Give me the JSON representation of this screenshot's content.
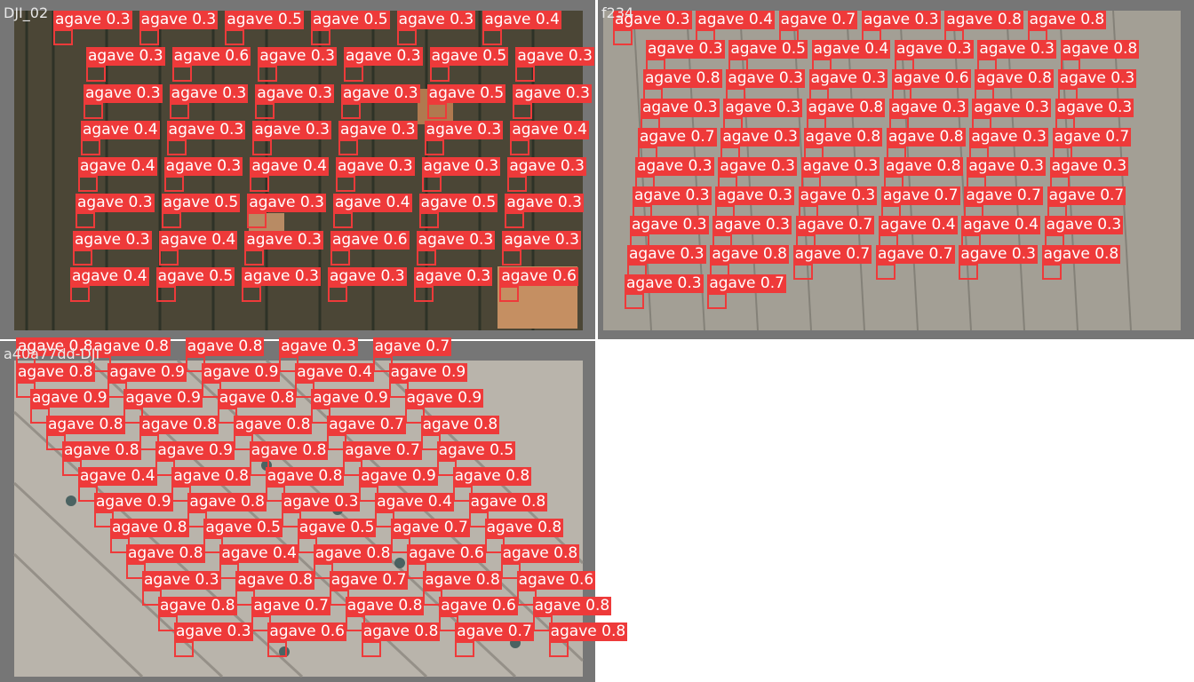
{
  "tiles": [
    {
      "name": "DJI_02",
      "scene": "field-dark-rows"
    },
    {
      "name": "f234",
      "scene": "field-sandy"
    },
    {
      "name": "a40a77dd-DJI",
      "scene": "field-diagonal"
    }
  ],
  "detection_class": "agave",
  "colors": {
    "box": "#ee3a3a",
    "label_text": "#ffffff",
    "frame": "#767676"
  },
  "detections": [
    {
      "tile": 0,
      "score": 0.3
    },
    {
      "tile": 0,
      "score": 0.3
    },
    {
      "tile": 0,
      "score": 0.5
    },
    {
      "tile": 0,
      "score": 0.5
    },
    {
      "tile": 0,
      "score": 0.3
    },
    {
      "tile": 0,
      "score": 0.4
    },
    {
      "tile": 0,
      "score": 0.3
    },
    {
      "tile": 0,
      "score": 0.6
    },
    {
      "tile": 0,
      "score": 0.3
    },
    {
      "tile": 0,
      "score": 0.3
    },
    {
      "tile": 0,
      "score": 0.5
    },
    {
      "tile": 0,
      "score": 0.3
    },
    {
      "tile": 0,
      "score": 0.3
    },
    {
      "tile": 0,
      "score": 0.3
    },
    {
      "tile": 0,
      "score": 0.3
    },
    {
      "tile": 0,
      "score": 0.3
    },
    {
      "tile": 0,
      "score": 0.5
    },
    {
      "tile": 0,
      "score": 0.3
    },
    {
      "tile": 0,
      "score": 0.4
    },
    {
      "tile": 0,
      "score": 0.3
    },
    {
      "tile": 0,
      "score": 0.3
    },
    {
      "tile": 0,
      "score": 0.3
    },
    {
      "tile": 0,
      "score": 0.3
    },
    {
      "tile": 0,
      "score": 0.4
    },
    {
      "tile": 0,
      "score": 0.4
    },
    {
      "tile": 0,
      "score": 0.3
    },
    {
      "tile": 0,
      "score": 0.4
    },
    {
      "tile": 0,
      "score": 0.3
    },
    {
      "tile": 0,
      "score": 0.3
    },
    {
      "tile": 0,
      "score": 0.3
    },
    {
      "tile": 0,
      "score": 0.3
    },
    {
      "tile": 0,
      "score": 0.5
    },
    {
      "tile": 0,
      "score": 0.3
    },
    {
      "tile": 0,
      "score": 0.4
    },
    {
      "tile": 0,
      "score": 0.5
    },
    {
      "tile": 0,
      "score": 0.3
    },
    {
      "tile": 0,
      "score": 0.3
    },
    {
      "tile": 0,
      "score": 0.4
    },
    {
      "tile": 0,
      "score": 0.3
    },
    {
      "tile": 0,
      "score": 0.6
    },
    {
      "tile": 0,
      "score": 0.3
    },
    {
      "tile": 0,
      "score": 0.3
    },
    {
      "tile": 0,
      "score": 0.4
    },
    {
      "tile": 0,
      "score": 0.5
    },
    {
      "tile": 0,
      "score": 0.3
    },
    {
      "tile": 0,
      "score": 0.3
    },
    {
      "tile": 0,
      "score": 0.3
    },
    {
      "tile": 0,
      "score": 0.6
    },
    {
      "tile": 1,
      "score": 0.3
    },
    {
      "tile": 1,
      "score": 0.4
    },
    {
      "tile": 1,
      "score": 0.7
    },
    {
      "tile": 1,
      "score": 0.3
    },
    {
      "tile": 1,
      "score": 0.8
    },
    {
      "tile": 1,
      "score": 0.8
    },
    {
      "tile": 1,
      "score": 0.3
    },
    {
      "tile": 1,
      "score": 0.5
    },
    {
      "tile": 1,
      "score": 0.4
    },
    {
      "tile": 1,
      "score": 0.3
    },
    {
      "tile": 1,
      "score": 0.3
    },
    {
      "tile": 1,
      "score": 0.8
    },
    {
      "tile": 1,
      "score": 0.8
    },
    {
      "tile": 1,
      "score": 0.3
    },
    {
      "tile": 1,
      "score": 0.3
    },
    {
      "tile": 1,
      "score": 0.6
    },
    {
      "tile": 1,
      "score": 0.8
    },
    {
      "tile": 1,
      "score": 0.3
    },
    {
      "tile": 1,
      "score": 0.3
    },
    {
      "tile": 1,
      "score": 0.3
    },
    {
      "tile": 1,
      "score": 0.8
    },
    {
      "tile": 1,
      "score": 0.3
    },
    {
      "tile": 1,
      "score": 0.3
    },
    {
      "tile": 1,
      "score": 0.3
    },
    {
      "tile": 1,
      "score": 0.7
    },
    {
      "tile": 1,
      "score": 0.3
    },
    {
      "tile": 1,
      "score": 0.8
    },
    {
      "tile": 1,
      "score": 0.8
    },
    {
      "tile": 1,
      "score": 0.3
    },
    {
      "tile": 1,
      "score": 0.7
    },
    {
      "tile": 1,
      "score": 0.3
    },
    {
      "tile": 1,
      "score": 0.3
    },
    {
      "tile": 1,
      "score": 0.3
    },
    {
      "tile": 1,
      "score": 0.8
    },
    {
      "tile": 1,
      "score": 0.3
    },
    {
      "tile": 1,
      "score": 0.3
    },
    {
      "tile": 1,
      "score": 0.3
    },
    {
      "tile": 1,
      "score": 0.3
    },
    {
      "tile": 1,
      "score": 0.3
    },
    {
      "tile": 1,
      "score": 0.7
    },
    {
      "tile": 1,
      "score": 0.7
    },
    {
      "tile": 1,
      "score": 0.7
    },
    {
      "tile": 1,
      "score": 0.3
    },
    {
      "tile": 1,
      "score": 0.3
    },
    {
      "tile": 1,
      "score": 0.7
    },
    {
      "tile": 1,
      "score": 0.4
    },
    {
      "tile": 1,
      "score": 0.4
    },
    {
      "tile": 1,
      "score": 0.3
    },
    {
      "tile": 1,
      "score": 0.3
    },
    {
      "tile": 1,
      "score": 0.8
    },
    {
      "tile": 1,
      "score": 0.7
    },
    {
      "tile": 1,
      "score": 0.7
    },
    {
      "tile": 1,
      "score": 0.3
    },
    {
      "tile": 1,
      "score": 0.8
    },
    {
      "tile": 1,
      "score": 0.3
    },
    {
      "tile": 1,
      "score": 0.7
    },
    {
      "tile": 2,
      "score": 0.8
    },
    {
      "tile": 2,
      "score": 0.8
    },
    {
      "tile": 2,
      "score": 0.8
    },
    {
      "tile": 2,
      "score": 0.3
    },
    {
      "tile": 2,
      "score": 0.7
    },
    {
      "tile": 2,
      "score": 0.8
    },
    {
      "tile": 2,
      "score": 0.9
    },
    {
      "tile": 2,
      "score": 0.9
    },
    {
      "tile": 2,
      "score": 0.4
    },
    {
      "tile": 2,
      "score": 0.9
    },
    {
      "tile": 2,
      "score": 0.9
    },
    {
      "tile": 2,
      "score": 0.9
    },
    {
      "tile": 2,
      "score": 0.8
    },
    {
      "tile": 2,
      "score": 0.9
    },
    {
      "tile": 2,
      "score": 0.9
    },
    {
      "tile": 2,
      "score": 0.8
    },
    {
      "tile": 2,
      "score": 0.8
    },
    {
      "tile": 2,
      "score": 0.8
    },
    {
      "tile": 2,
      "score": 0.7
    },
    {
      "tile": 2,
      "score": 0.8
    },
    {
      "tile": 2,
      "score": 0.8
    },
    {
      "tile": 2,
      "score": 0.9
    },
    {
      "tile": 2,
      "score": 0.8
    },
    {
      "tile": 2,
      "score": 0.7
    },
    {
      "tile": 2,
      "score": 0.5
    },
    {
      "tile": 2,
      "score": 0.4
    },
    {
      "tile": 2,
      "score": 0.8
    },
    {
      "tile": 2,
      "score": 0.8
    },
    {
      "tile": 2,
      "score": 0.9
    },
    {
      "tile": 2,
      "score": 0.8
    },
    {
      "tile": 2,
      "score": 0.9
    },
    {
      "tile": 2,
      "score": 0.8
    },
    {
      "tile": 2,
      "score": 0.3
    },
    {
      "tile": 2,
      "score": 0.4
    },
    {
      "tile": 2,
      "score": 0.8
    },
    {
      "tile": 2,
      "score": 0.8
    },
    {
      "tile": 2,
      "score": 0.5
    },
    {
      "tile": 2,
      "score": 0.5
    },
    {
      "tile": 2,
      "score": 0.7
    },
    {
      "tile": 2,
      "score": 0.8
    },
    {
      "tile": 2,
      "score": 0.8
    },
    {
      "tile": 2,
      "score": 0.4
    },
    {
      "tile": 2,
      "score": 0.8
    },
    {
      "tile": 2,
      "score": 0.6
    },
    {
      "tile": 2,
      "score": 0.8
    },
    {
      "tile": 2,
      "score": 0.3
    },
    {
      "tile": 2,
      "score": 0.8
    },
    {
      "tile": 2,
      "score": 0.7
    },
    {
      "tile": 2,
      "score": 0.8
    },
    {
      "tile": 2,
      "score": 0.6
    },
    {
      "tile": 2,
      "score": 0.8
    },
    {
      "tile": 2,
      "score": 0.7
    },
    {
      "tile": 2,
      "score": 0.8
    },
    {
      "tile": 2,
      "score": 0.6
    },
    {
      "tile": 2,
      "score": 0.8
    },
    {
      "tile": 2,
      "score": 0.3
    },
    {
      "tile": 2,
      "score": 0.6
    },
    {
      "tile": 2,
      "score": 0.8
    },
    {
      "tile": 2,
      "score": 0.7
    },
    {
      "tile": 2,
      "score": 0.8
    }
  ]
}
